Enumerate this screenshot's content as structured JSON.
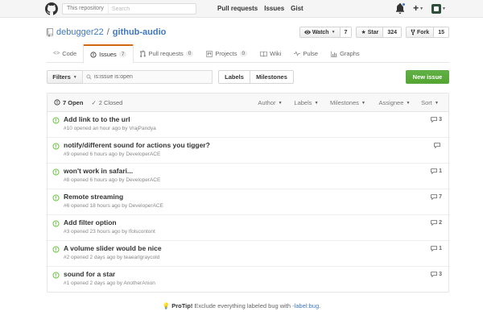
{
  "header": {
    "search_scope": "This repository",
    "search_placeholder": "Search",
    "nav": [
      "Pull requests",
      "Issues",
      "Gist"
    ]
  },
  "repo": {
    "owner": "debugger22",
    "separator": "/",
    "name": "github-audio",
    "watch_label": "Watch",
    "watch_count": "7",
    "star_label": "Star",
    "star_count": "324",
    "fork_label": "Fork",
    "fork_count": "15"
  },
  "tabs": [
    {
      "label": "Code",
      "icon": "code-icon"
    },
    {
      "label": "Issues",
      "count": "7",
      "icon": "issue-opened-icon"
    },
    {
      "label": "Pull requests",
      "count": "0",
      "icon": "git-pull-request-icon"
    },
    {
      "label": "Projects",
      "count": "0",
      "icon": "project-icon"
    },
    {
      "label": "Wiki",
      "icon": "book-icon"
    },
    {
      "label": "Pulse",
      "icon": "pulse-icon"
    },
    {
      "label": "Graphs",
      "icon": "graph-icon"
    }
  ],
  "filter_bar": {
    "filters_label": "Filters",
    "query": "is:issue is:open",
    "labels_label": "Labels",
    "milestones_label": "Milestones",
    "new_issue_label": "New issue"
  },
  "table_head": {
    "open_label": "7 Open",
    "closed_label": "2 Closed",
    "filters": [
      "Author",
      "Labels",
      "Milestones",
      "Assignee",
      "Sort"
    ]
  },
  "issues": [
    {
      "title": "Add link to to the url",
      "meta": "#10 opened an hour ago by VrajPandya",
      "comments": "3"
    },
    {
      "title": "notify/different sound for actions you tigger?",
      "meta": "#9 opened 6 hours ago by DeveloperACE",
      "comments": ""
    },
    {
      "title": "won't work in safari...",
      "meta": "#8 opened 6 hours ago by DeveloperACE",
      "comments": "1"
    },
    {
      "title": "Remote streaming",
      "meta": "#6 opened 18 hours ago by DeveloperACE",
      "comments": "7"
    },
    {
      "title": "Add filter option",
      "meta": "#3 opened 23 hours ago by lfolscontont",
      "comments": "2"
    },
    {
      "title": "A volume slider would be nice",
      "meta": "#2 opened 2 days ago by teaearlgraycold",
      "comments": "1"
    },
    {
      "title": "sound for a star",
      "meta": "#1 opened 2 days ago by AnotherAnion",
      "comments": "3"
    }
  ],
  "protip": {
    "prefix": "ProTip!",
    "text": "Exclude everything labeled bug with",
    "query": "-label:bug",
    "suffix": "."
  },
  "colors": {
    "link": "#4078c0",
    "open_green": "#6cc644",
    "new_issue_green": "#55a532",
    "active_tab": "#d26911"
  }
}
